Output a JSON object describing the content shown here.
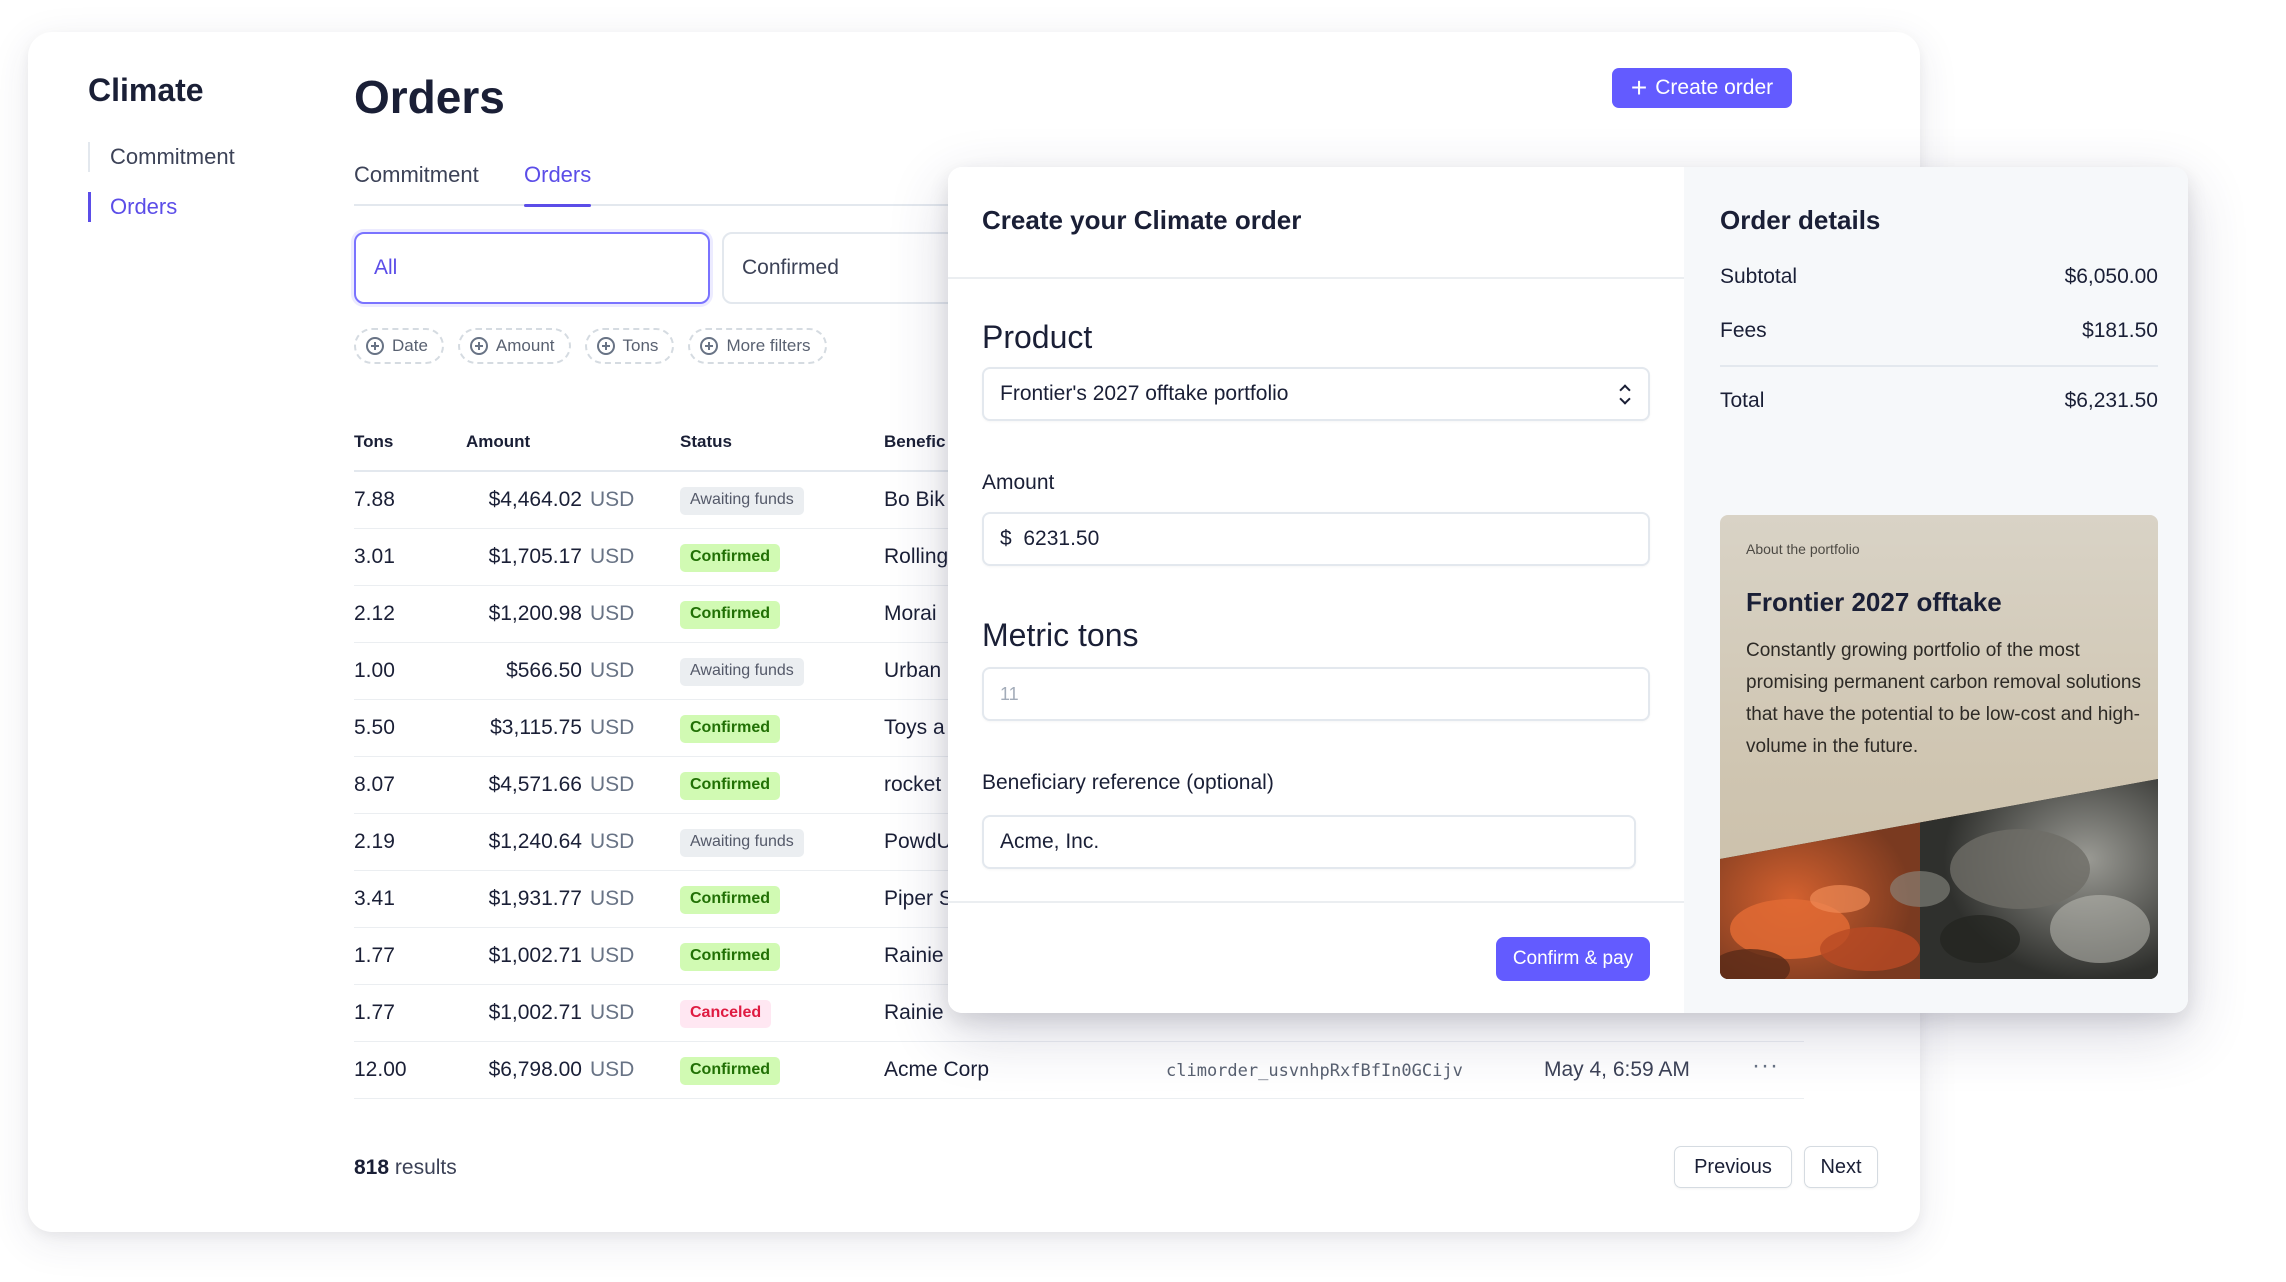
{
  "sidebar": {
    "title": "Climate",
    "items": [
      {
        "label": "Commitment",
        "active": false
      },
      {
        "label": "Orders",
        "active": true
      }
    ]
  },
  "header": {
    "title": "Orders",
    "create_button": "Create order"
  },
  "tabs": [
    {
      "label": "Commitment",
      "active": false
    },
    {
      "label": "Orders",
      "active": true
    }
  ],
  "segments": [
    {
      "label": "All",
      "active": true
    },
    {
      "label": "Confirmed",
      "active": false
    }
  ],
  "filter_chips": [
    "Date",
    "Amount",
    "Tons",
    "More filters"
  ],
  "table": {
    "columns": [
      "Tons",
      "Amount",
      "Status",
      "Benefic"
    ],
    "rows": [
      {
        "tons": "7.88",
        "amount": "$4,464.02",
        "currency": "USD",
        "status": "Awaiting funds",
        "beneficiary": "Bo Bik"
      },
      {
        "tons": "3.01",
        "amount": "$1,705.17",
        "currency": "USD",
        "status": "Confirmed",
        "beneficiary": "Rolling"
      },
      {
        "tons": "2.12",
        "amount": "$1,200.98",
        "currency": "USD",
        "status": "Confirmed",
        "beneficiary": "Morai"
      },
      {
        "tons": "1.00",
        "amount": "$566.50",
        "currency": "USD",
        "status": "Awaiting funds",
        "beneficiary": "Urban"
      },
      {
        "tons": "5.50",
        "amount": "$3,115.75",
        "currency": "USD",
        "status": "Confirmed",
        "beneficiary": "Toys a"
      },
      {
        "tons": "8.07",
        "amount": "$4,571.66",
        "currency": "USD",
        "status": "Confirmed",
        "beneficiary": "rocket"
      },
      {
        "tons": "2.19",
        "amount": "$1,240.64",
        "currency": "USD",
        "status": "Awaiting funds",
        "beneficiary": "PowdU"
      },
      {
        "tons": "3.41",
        "amount": "$1,931.77",
        "currency": "USD",
        "status": "Confirmed",
        "beneficiary": "Piper S"
      },
      {
        "tons": "1.77",
        "amount": "$1,002.71",
        "currency": "USD",
        "status": "Confirmed",
        "beneficiary": "Rainie"
      },
      {
        "tons": "1.77",
        "amount": "$1,002.71",
        "currency": "USD",
        "status": "Canceled",
        "beneficiary": "Rainie"
      },
      {
        "tons": "12.00",
        "amount": "$6,798.00",
        "currency": "USD",
        "status": "Confirmed",
        "beneficiary": "Acme Corp",
        "order_id": "climorder_usvnhpRxfBfIn0GCijv",
        "date": "May 4, 6:59 AM",
        "more": "···"
      }
    ]
  },
  "results": {
    "count": "818",
    "suffix": "results"
  },
  "pagination": {
    "previous": "Previous",
    "next": "Next"
  },
  "modal": {
    "title": "Create your Climate order",
    "product_label": "Product",
    "product_value": "Frontier's 2027 offtake portfolio",
    "amount_label": "Amount",
    "amount_value": "$  6231.50",
    "tons_label": "Metric tons",
    "tons_placeholder": "11",
    "beneficiary_label": "Beneficiary reference (optional)",
    "beneficiary_value": "Acme, Inc.",
    "confirm_button": "Confirm & pay"
  },
  "order_details": {
    "title": "Order details",
    "subtotal_label": "Subtotal",
    "subtotal_value": "$6,050.00",
    "fees_label": "Fees",
    "fees_value": "$181.50",
    "total_label": "Total",
    "total_value": "$6,231.50",
    "portfolio": {
      "kicker": "About the portfolio",
      "title": "Frontier 2027 offtake",
      "description": "Constantly growing portfolio of the most promising permanent carbon removal solutions that have the potential to be low-cost and high-volume in the future."
    }
  },
  "colors": {
    "accent": "#635bff",
    "confirmed_bg": "#d1fab3",
    "confirmed_text": "#217005",
    "canceled_bg": "#ffe7f2",
    "canceled_text": "#df1b41",
    "awaiting_bg": "#ebeef1"
  }
}
